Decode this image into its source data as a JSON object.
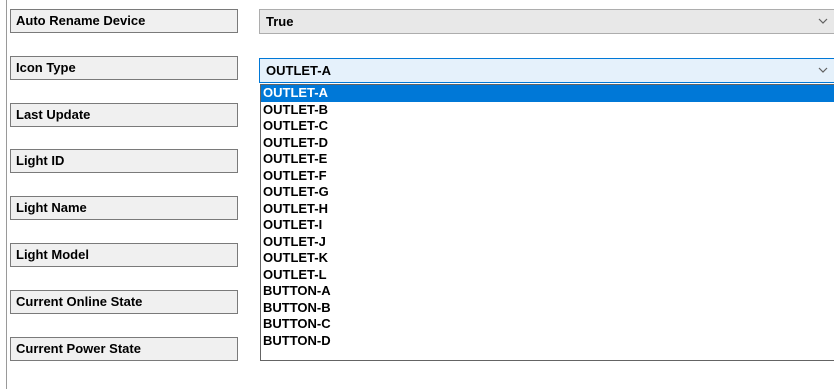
{
  "properties": [
    {
      "label": "Auto Rename Device"
    },
    {
      "label": "Icon Type"
    },
    {
      "label": "Last Update"
    },
    {
      "label": "Light ID"
    },
    {
      "label": "Light Name"
    },
    {
      "label": "Light Model"
    },
    {
      "label": "Current Online State"
    },
    {
      "label": "Current Power State"
    }
  ],
  "auto_rename_value": "True",
  "icon_type_value": "OUTLET-A",
  "icon_type_options": [
    "OUTLET-A",
    "OUTLET-B",
    "OUTLET-C",
    "OUTLET-D",
    "OUTLET-E",
    "OUTLET-F",
    "OUTLET-G",
    "OUTLET-H",
    "OUTLET-I",
    "OUTLET-J",
    "OUTLET-K",
    "OUTLET-L",
    "BUTTON-A",
    "BUTTON-B",
    "BUTTON-C",
    "BUTTON-D"
  ],
  "selected_option_index": 0,
  "colors": {
    "selection": "#0078d7",
    "focus_border": "#0078d7",
    "label_bg": "#f0f0f0"
  },
  "icons": {
    "dropdown": "chevron-down-icon"
  }
}
